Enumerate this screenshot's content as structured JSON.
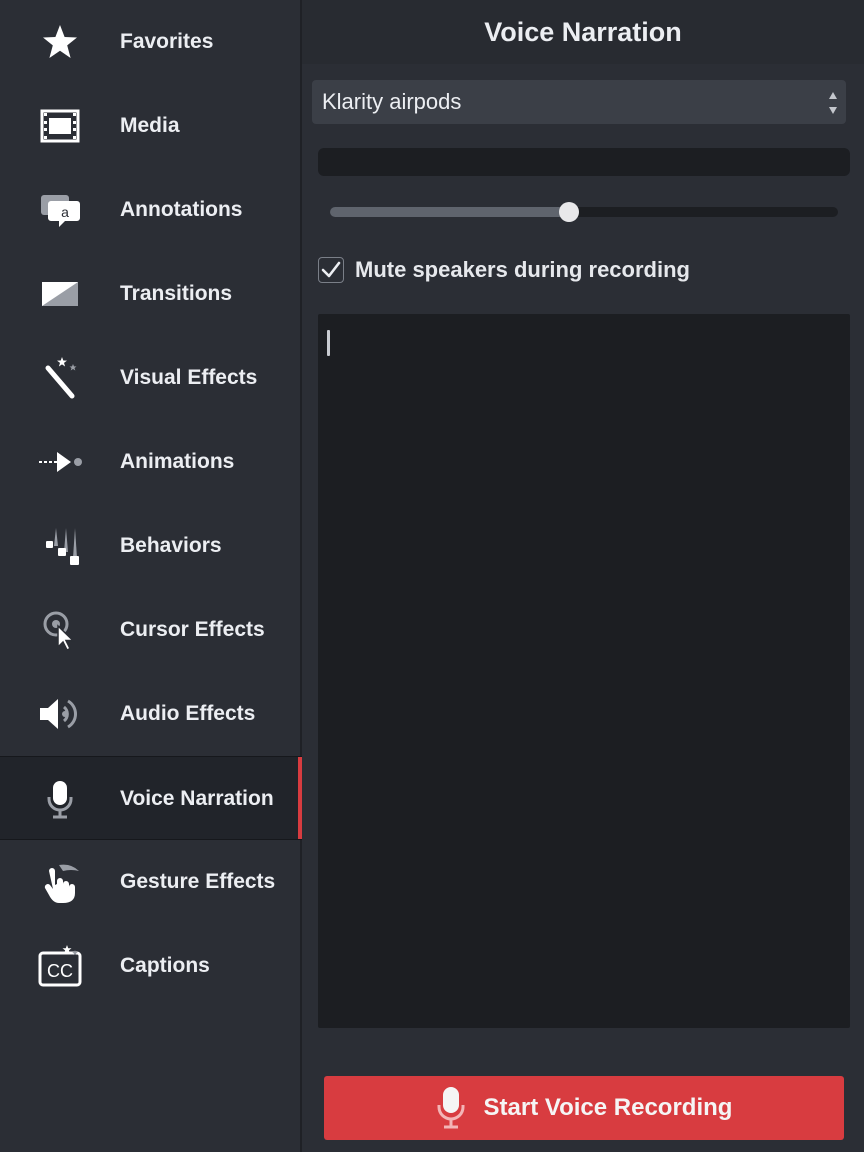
{
  "sidebar": {
    "items": [
      {
        "label": "Favorites",
        "icon": "star-icon"
      },
      {
        "label": "Media",
        "icon": "film-strip-icon"
      },
      {
        "label": "Annotations",
        "icon": "callout-icon"
      },
      {
        "label": "Transitions",
        "icon": "transition-icon"
      },
      {
        "label": "Visual Effects",
        "icon": "magic-wand-icon"
      },
      {
        "label": "Animations",
        "icon": "arrow-path-icon"
      },
      {
        "label": "Behaviors",
        "icon": "behaviors-icon"
      },
      {
        "label": "Cursor Effects",
        "icon": "cursor-icon"
      },
      {
        "label": "Audio Effects",
        "icon": "speaker-icon"
      },
      {
        "label": "Voice Narration",
        "icon": "microphone-icon",
        "active": true
      },
      {
        "label": "Gesture Effects",
        "icon": "hand-icon"
      },
      {
        "label": "Captions",
        "icon": "captions-icon"
      }
    ]
  },
  "panel": {
    "title": "Voice Narration",
    "device": {
      "selected": "Klarity airpods"
    },
    "input_level": 0.47,
    "mute": {
      "label": "Mute speakers during recording",
      "checked": true
    },
    "script_text": "",
    "record_button": {
      "label": "Start Voice Recording",
      "icon": "microphone-icon"
    }
  },
  "colors": {
    "accent": "#d83c40",
    "background": "#2b2e35",
    "panel_dark": "#1c1e22",
    "text": "#eceef2"
  }
}
